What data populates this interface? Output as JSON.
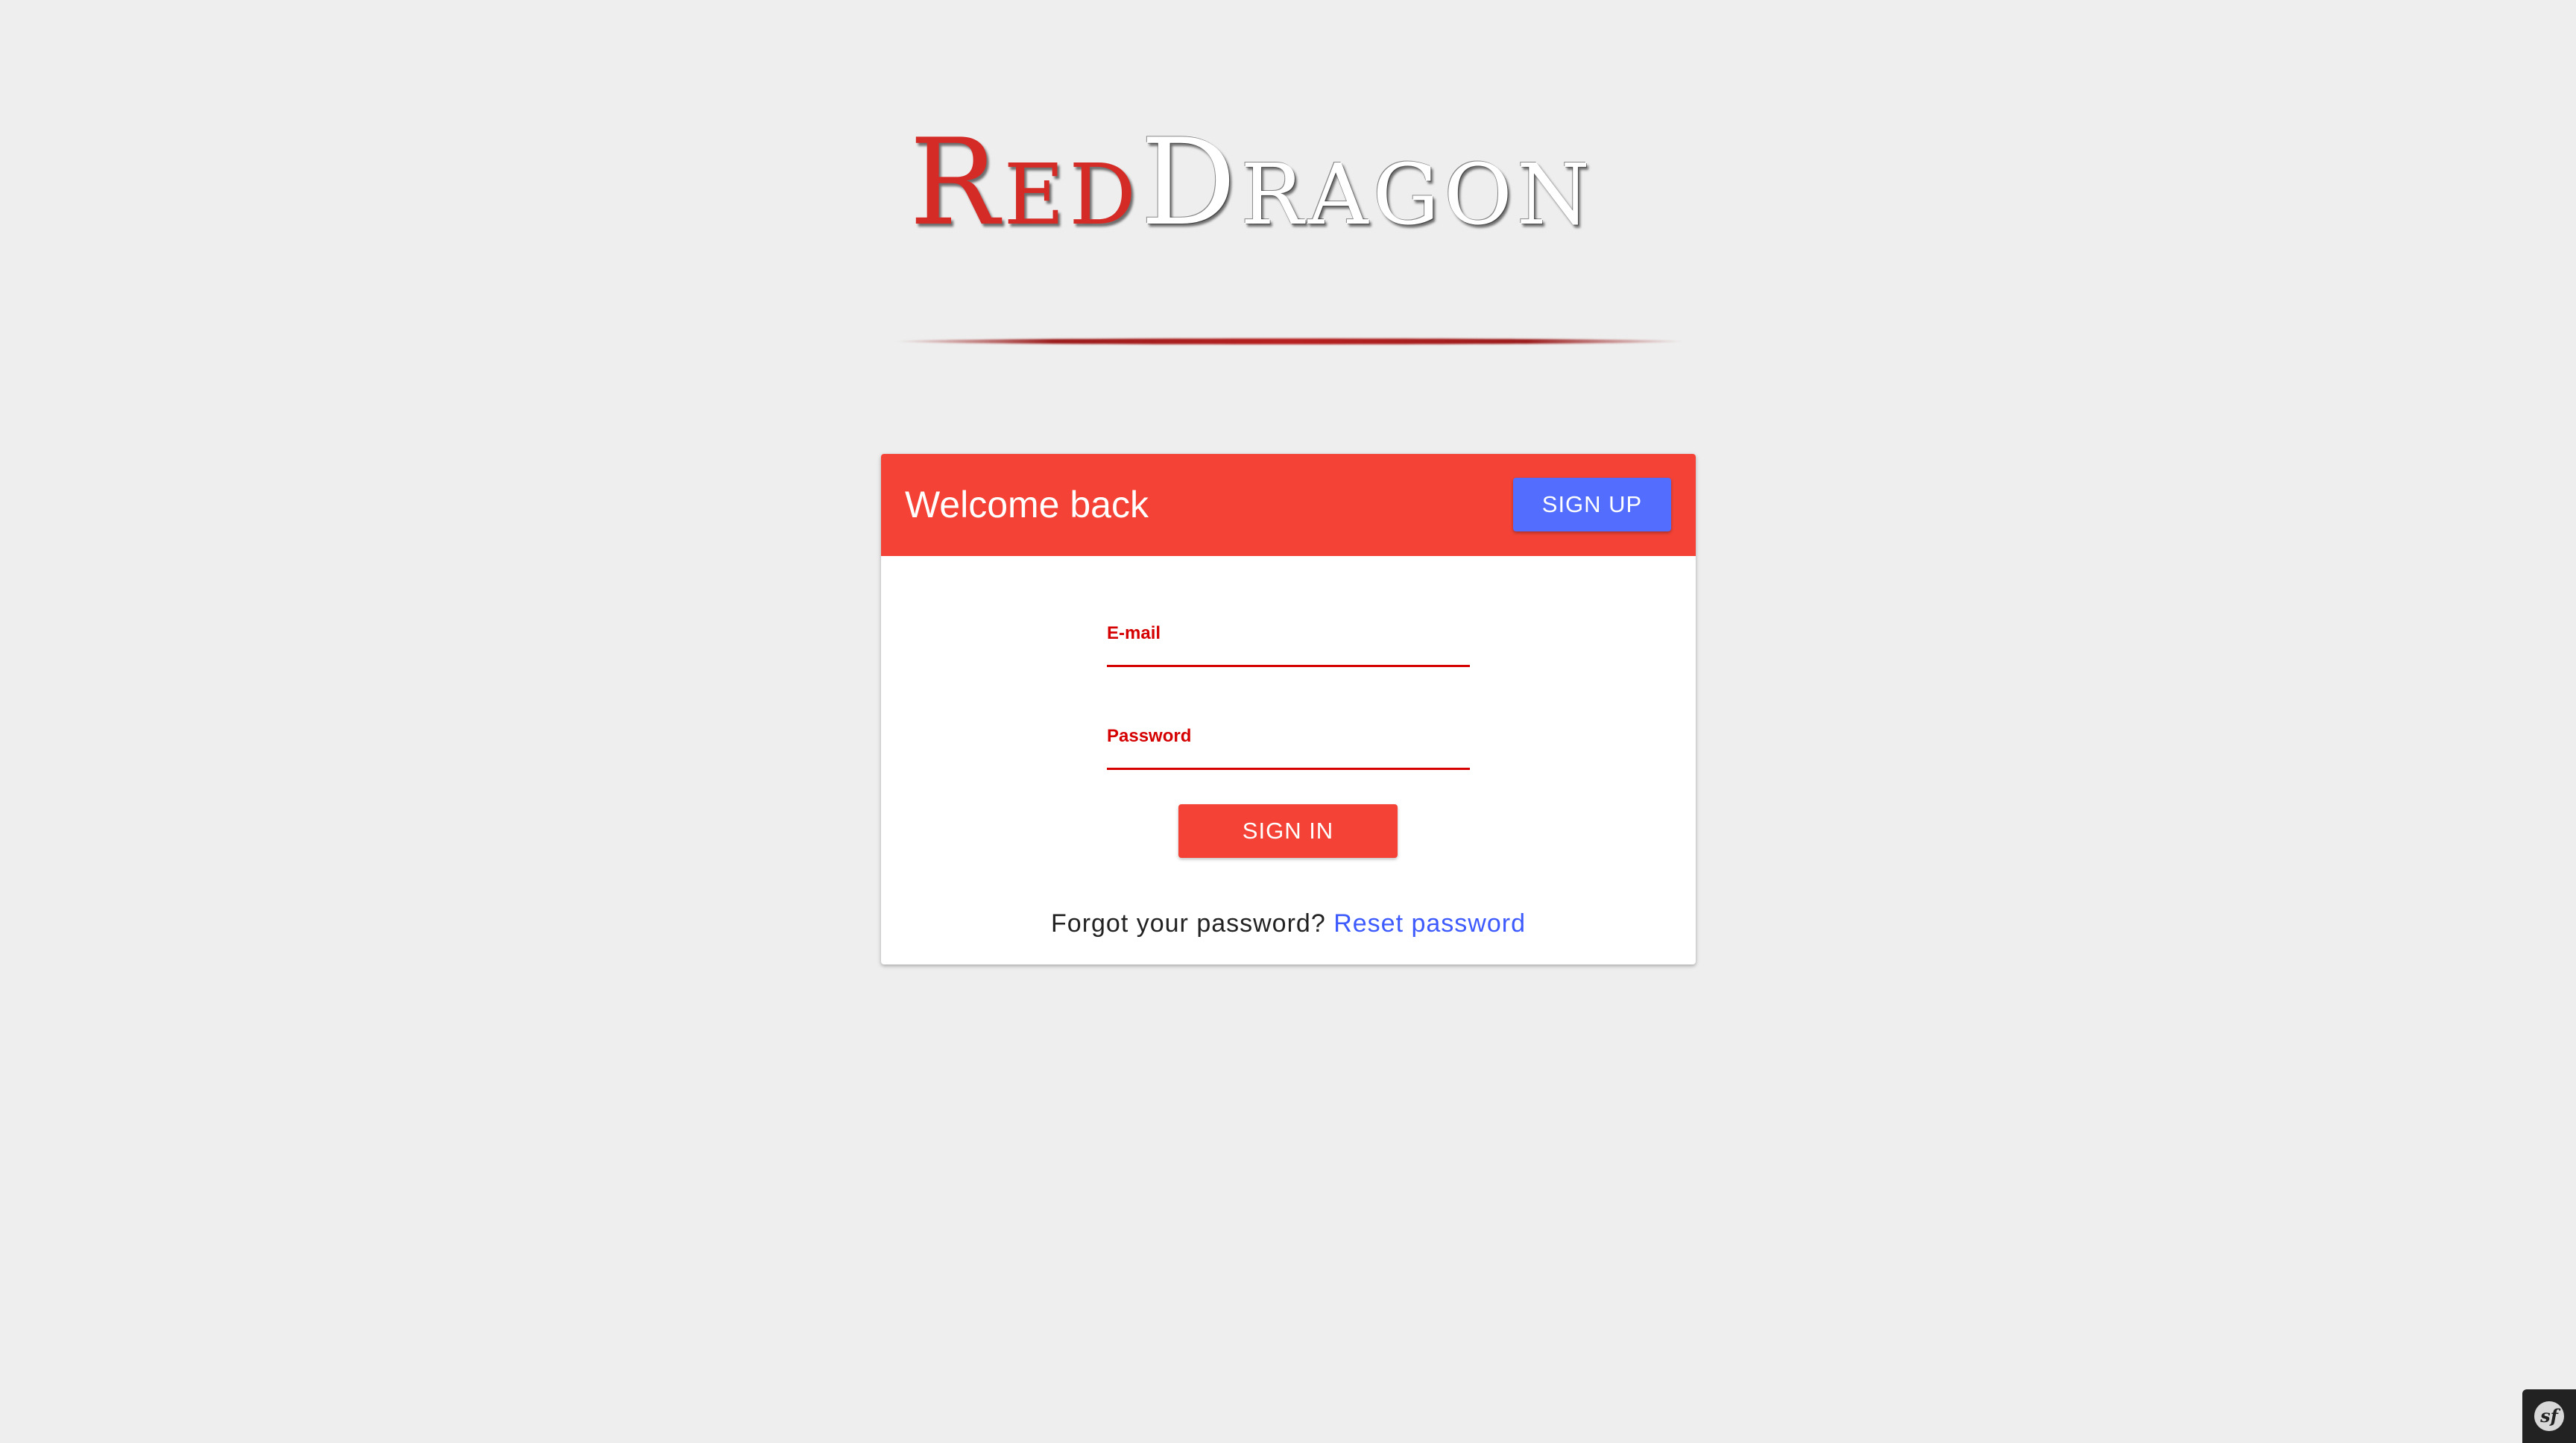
{
  "logo": {
    "part1_initial": "R",
    "part1_rest": "ED",
    "part2_initial": "D",
    "part2_rest": "RAGON"
  },
  "card": {
    "title": "Welcome back",
    "signup_label": "SIGN UP",
    "email_label": "E-mail",
    "email_value": "",
    "password_label": "Password",
    "password_value": "",
    "signin_label": "SIGN IN",
    "forgot_text": "Forgot your password?",
    "reset_link": "Reset password"
  },
  "debug_toolbar": {
    "icon": "symfony-icon",
    "glyph": "sf"
  },
  "colors": {
    "background": "#eeeeee",
    "header": "#f44336",
    "signup_button": "#536dfe",
    "field_accent": "#d50000",
    "link": "#3d5afe"
  }
}
